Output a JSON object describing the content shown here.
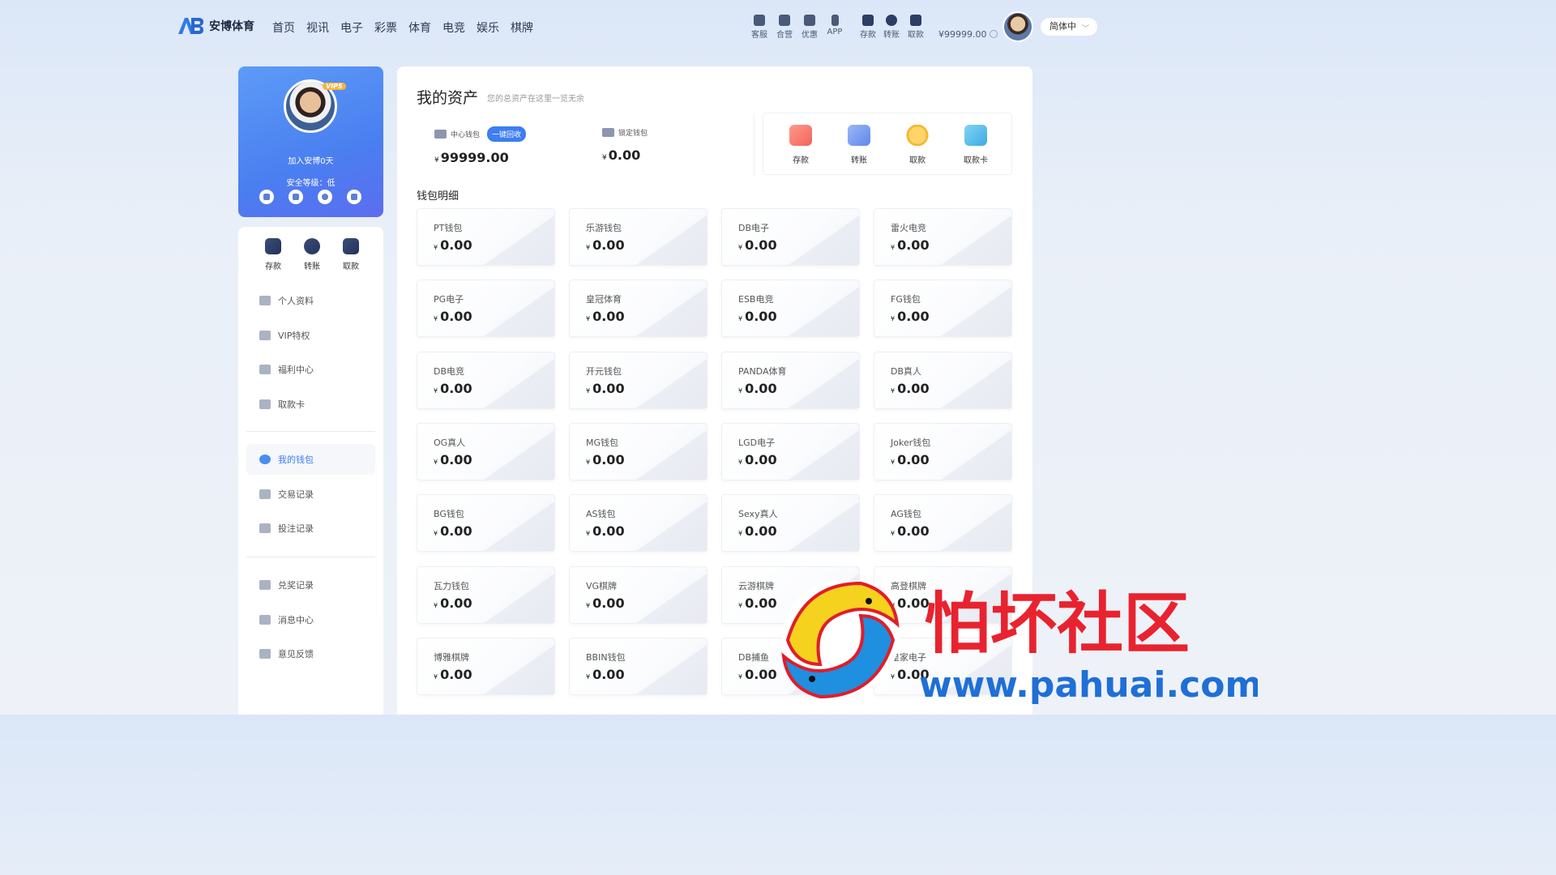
{
  "brand": {
    "name": "安博体育"
  },
  "nav": [
    "首页",
    "视讯",
    "电子",
    "彩票",
    "体育",
    "电竞",
    "娱乐",
    "棋牌"
  ],
  "tools": [
    "客服",
    "合营",
    "优惠",
    "APP",
    "存款",
    "转账",
    "取款"
  ],
  "top_balance": "¥99999.00",
  "language": "简体中",
  "profile": {
    "vip": "VIP5",
    "join_text": "加入安博0天",
    "security_text": "安全等级：低"
  },
  "quick": [
    "存款",
    "转账",
    "取款"
  ],
  "menu_group1": [
    "个人资料",
    "VIP特权",
    "福利中心",
    "取款卡"
  ],
  "menu_group2": [
    "我的钱包",
    "交易记录",
    "投注记录"
  ],
  "menu_group3": [
    "兑奖记录",
    "消息中心",
    "意见反馈"
  ],
  "active_menu": "我的钱包",
  "main": {
    "title": "我的资产",
    "subtitle": "您的总资产在这里一览无余",
    "center_wallet": {
      "label": "中心钱包",
      "recall": "一键回收",
      "currency": "¥",
      "amount": "99999.00"
    },
    "locked_wallet": {
      "label": "锁定钱包",
      "currency": "¥",
      "amount": "0.00"
    },
    "actions": [
      "存款",
      "转账",
      "取款",
      "取款卡"
    ],
    "section_title": "钱包明细"
  },
  "wallets": [
    {
      "name": "PT钱包",
      "amount": "0.00"
    },
    {
      "name": "乐游钱包",
      "amount": "0.00"
    },
    {
      "name": "DB电子",
      "amount": "0.00"
    },
    {
      "name": "雷火电竞",
      "amount": "0.00"
    },
    {
      "name": "PG电子",
      "amount": "0.00"
    },
    {
      "name": "皇冠体育",
      "amount": "0.00"
    },
    {
      "name": "ESB电竞",
      "amount": "0.00"
    },
    {
      "name": "FG钱包",
      "amount": "0.00"
    },
    {
      "name": "DB电竞",
      "amount": "0.00"
    },
    {
      "name": "开元钱包",
      "amount": "0.00"
    },
    {
      "name": "PANDA体育",
      "amount": "0.00"
    },
    {
      "name": "DB真人",
      "amount": "0.00"
    },
    {
      "name": "OG真人",
      "amount": "0.00"
    },
    {
      "name": "MG钱包",
      "amount": "0.00"
    },
    {
      "name": "LGD电子",
      "amount": "0.00"
    },
    {
      "name": "Joker钱包",
      "amount": "0.00"
    },
    {
      "name": "BG钱包",
      "amount": "0.00"
    },
    {
      "name": "AS钱包",
      "amount": "0.00"
    },
    {
      "name": "Sexy真人",
      "amount": "0.00"
    },
    {
      "name": "AG钱包",
      "amount": "0.00"
    },
    {
      "name": "瓦力钱包",
      "amount": "0.00"
    },
    {
      "name": "VG棋牌",
      "amount": "0.00"
    },
    {
      "name": "云游棋牌",
      "amount": "0.00"
    },
    {
      "name": "高登棋牌",
      "amount": "0.00"
    },
    {
      "name": "博雅棋牌",
      "amount": "0.00"
    },
    {
      "name": "BBIN钱包",
      "amount": "0.00"
    },
    {
      "name": "DB捕鱼",
      "amount": "0.00"
    },
    {
      "name": "皇家电子",
      "amount": "0.00"
    }
  ],
  "currency": "¥",
  "watermark": {
    "text": "怕坏社区",
    "url": "www.pahuai.com"
  },
  "colors": {
    "accent": "#3d7ef0",
    "watermark_red": "#e8232f",
    "watermark_blue": "#1f6fd6"
  }
}
